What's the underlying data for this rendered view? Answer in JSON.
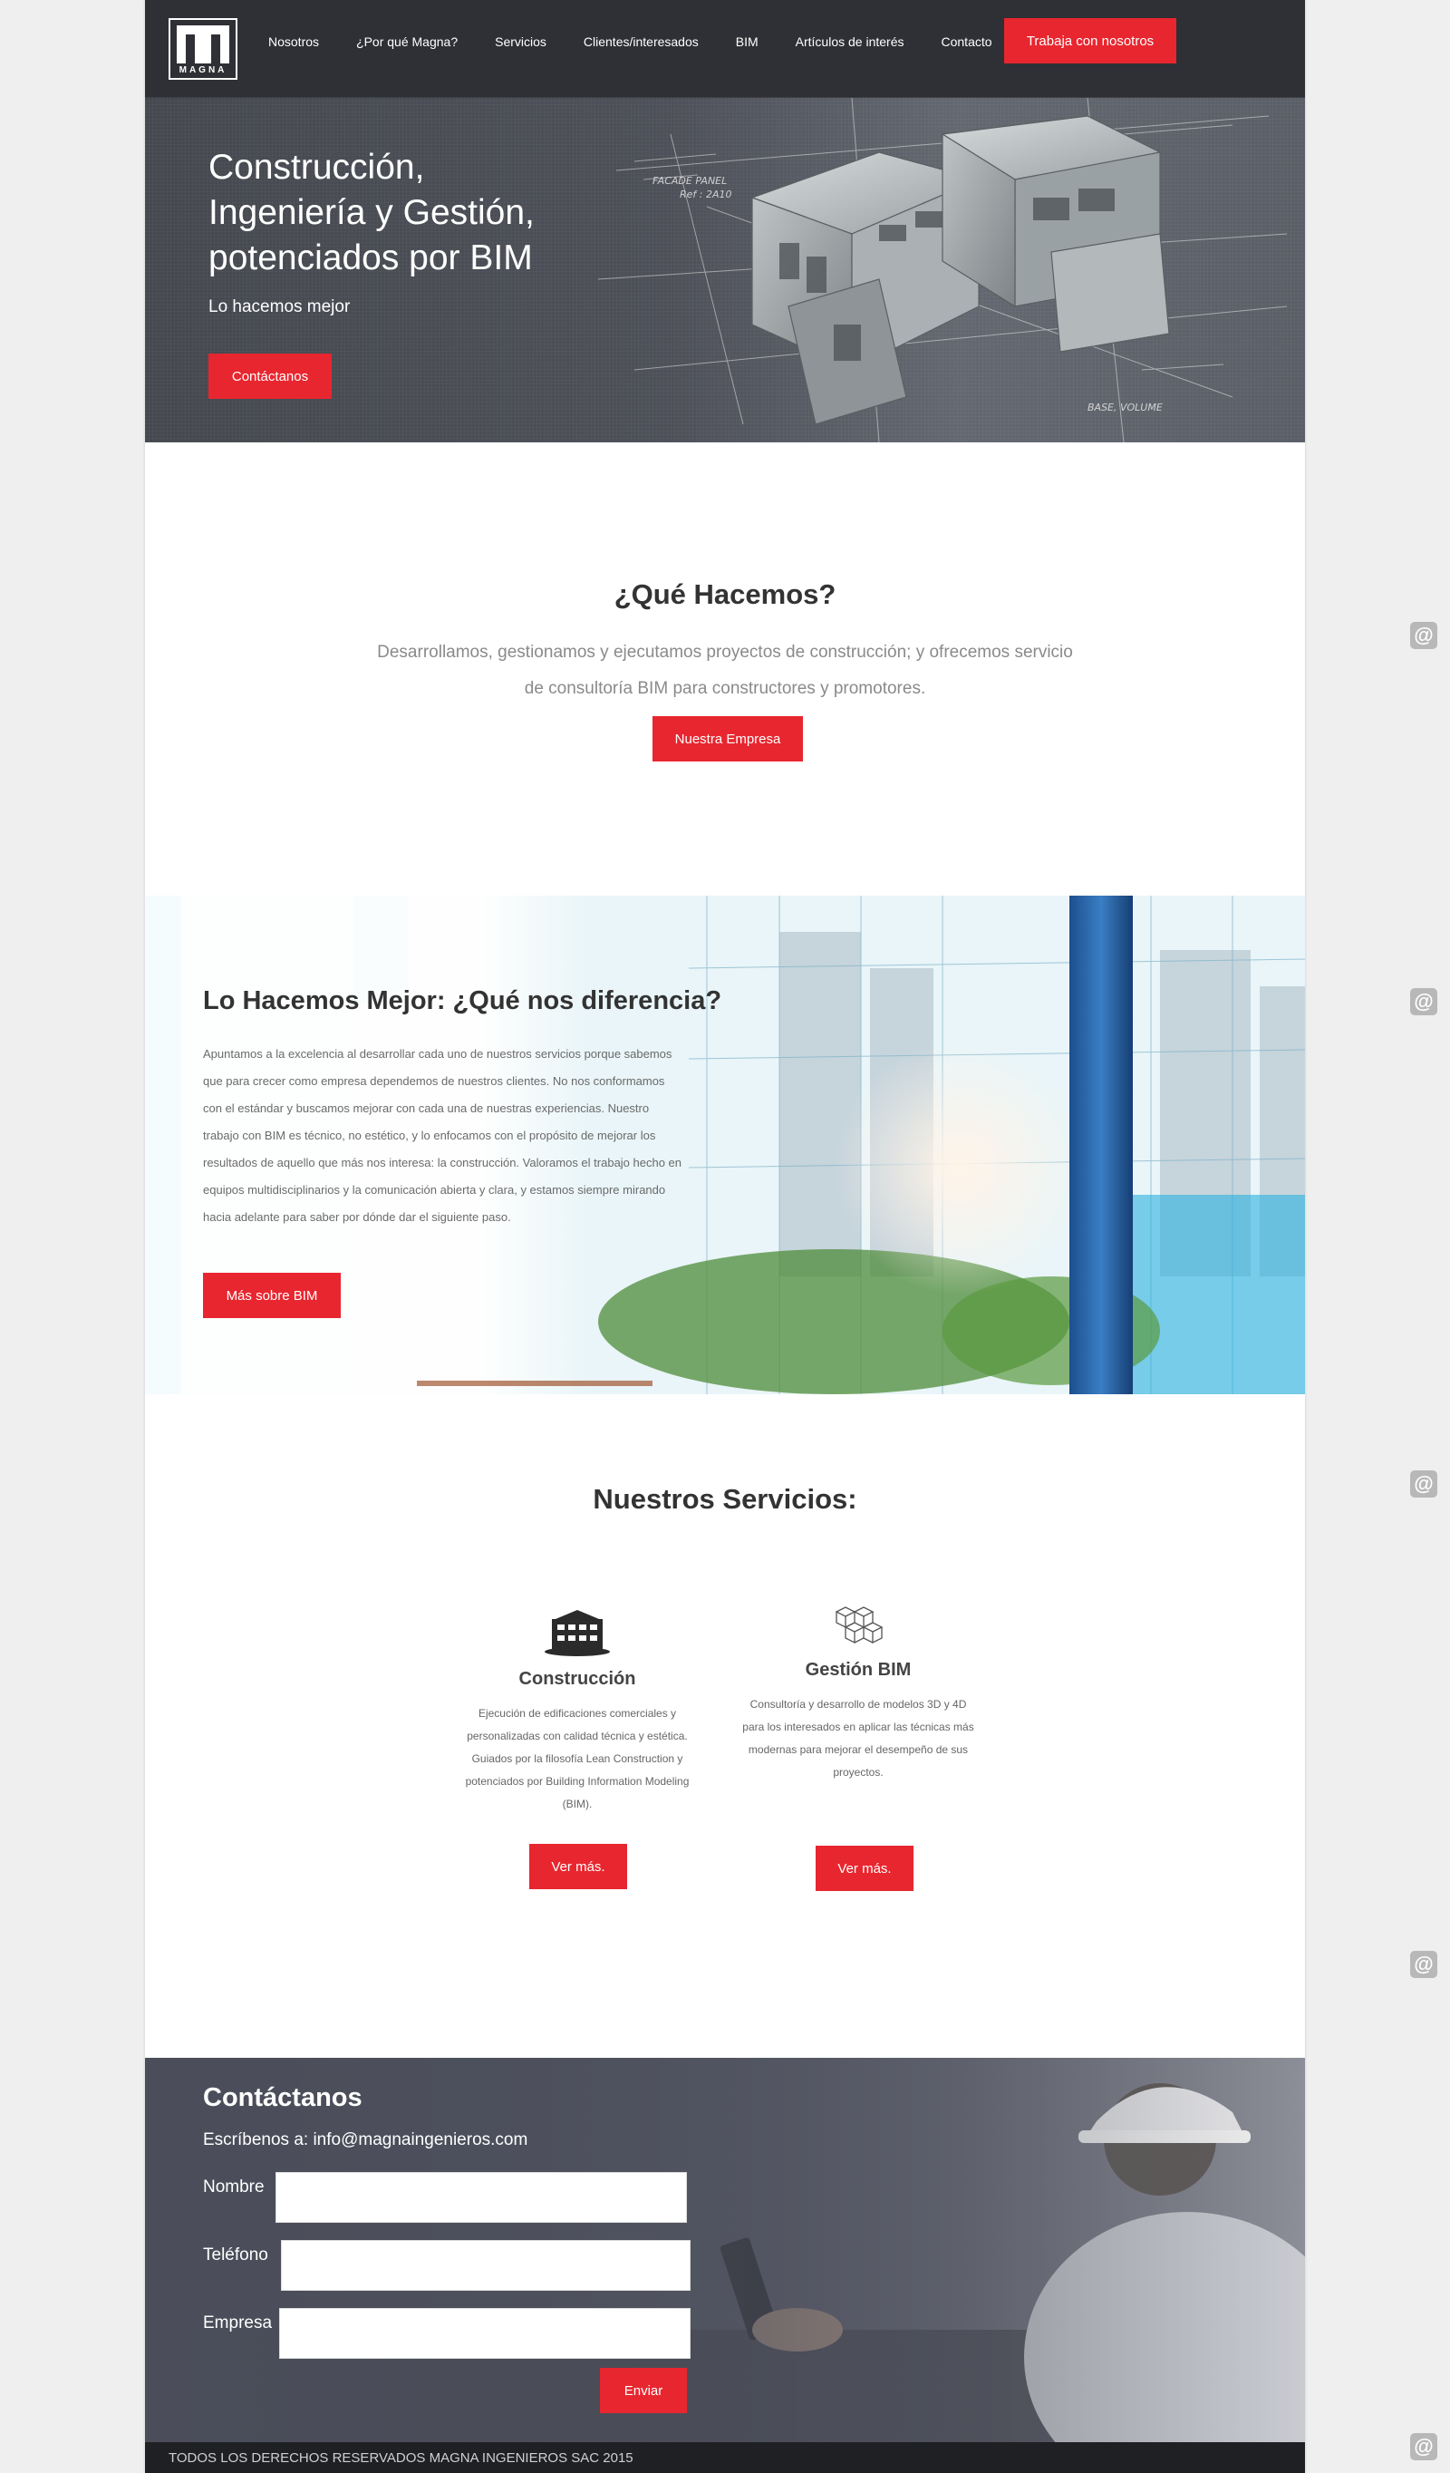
{
  "header": {
    "logo_text": "MAGNA",
    "nav": [
      "Nosotros",
      "¿Por qué Magna?",
      "Servicios",
      "Clientes/interesados",
      "BIM",
      "Artículos de interés",
      "Contacto"
    ],
    "cta": "Trabaja con nosotros"
  },
  "hero": {
    "title": "Construcción, Ingeniería y Gestión, potenciados por BIM",
    "subtitle": "Lo hacemos mejor",
    "button": "Contáctanos"
  },
  "que_hacemos": {
    "title": "¿Qué Hacemos?",
    "text": "Desarrollamos, gestionamos y ejecutamos proyectos de construcción; y ofrecemos servicio de consultoría BIM para constructores y promotores.",
    "button": "Nuestra Empresa"
  },
  "diferencia": {
    "title": "Lo Hacemos Mejor: ¿Qué nos diferencia?",
    "text": "Apuntamos a la excelencia al desarrollar cada uno de nuestros servicios porque sabemos que para crecer como empresa dependemos de nuestros clientes. No nos conformamos con el estándar y buscamos mejorar con cada una de nuestras experiencias. Nuestro trabajo con BIM es técnico, no estético, y lo enfocamos con el propósito de mejorar los resultados de aquello que más nos interesa: la construcción. Valoramos el trabajo hecho en equipos multidisciplinarios y la comunicación abierta y clara, y estamos siempre mirando hacia adelante para saber por dónde dar el siguiente paso.",
    "button": "Más sobre BIM"
  },
  "servicios": {
    "title": "Nuestros Servicios:",
    "items": [
      {
        "icon": "building-icon",
        "title": "Construcción",
        "text": "Ejecución de edificaciones comerciales y personalizadas con calidad técnica y estética. Guiados por la filosofía Lean Construction y potenciados por Building Information Modeling (BIM).",
        "button": "Ver más."
      },
      {
        "icon": "cubes-icon",
        "title": "Gestión BIM",
        "text": "Consultoría y desarrollo de modelos 3D y 4D para los interesados en aplicar las técnicas más modernas para mejorar el desempeño de sus proyectos.",
        "button": "Ver más."
      }
    ]
  },
  "contacto": {
    "title": "Contáctanos",
    "email_line": "Escríbenos a: info@magnaingenieros.com",
    "fields": [
      {
        "label": "Nombre",
        "value": ""
      },
      {
        "label": "Teléfono",
        "value": ""
      },
      {
        "label": "Empresa",
        "value": ""
      }
    ],
    "submit": "Enviar"
  },
  "footer": {
    "text": "TODOS LOS DERECHOS RESERVADOS MAGNA INGENIEROS SAC 2015"
  },
  "side_icons": [
    "@",
    "@",
    "@",
    "@",
    "@"
  ],
  "colors": {
    "accent": "#e8262f",
    "header_bg": "#2f3035",
    "footer_bg": "#1f2024"
  }
}
